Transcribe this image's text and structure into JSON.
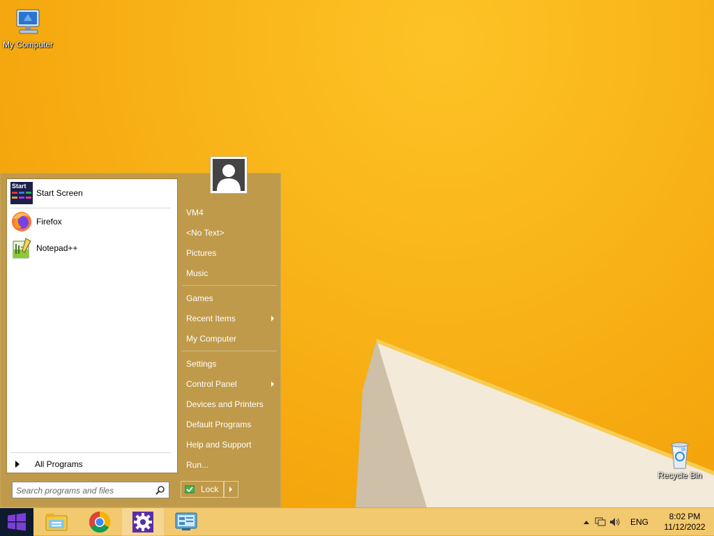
{
  "desktop": {
    "icons": [
      {
        "label": "My Computer"
      },
      {
        "label": "Recycle Bin"
      }
    ]
  },
  "start_menu": {
    "pinned": [
      {
        "label": "Start Screen",
        "icon": "start-screen-icon",
        "icon_text": "Start"
      },
      {
        "label": "Firefox",
        "icon": "firefox-icon"
      },
      {
        "label": "Notepad++",
        "icon": "notepad-plus-plus-icon"
      }
    ],
    "all_programs": "All Programs",
    "search_placeholder": "Search programs and files",
    "user_picture": "user-avatar-icon",
    "right_items": [
      {
        "label": "VM4",
        "submenu": false
      },
      {
        "label": "<No Text>",
        "submenu": false
      },
      {
        "label": "Pictures",
        "submenu": false
      },
      {
        "label": "Music",
        "submenu": false
      },
      {
        "label": "Games",
        "submenu": false
      },
      {
        "label": "Recent Items",
        "submenu": true
      },
      {
        "label": "My Computer",
        "submenu": false
      },
      {
        "label": "Settings",
        "submenu": false
      },
      {
        "label": "Control Panel",
        "submenu": true
      },
      {
        "label": "Devices and Printers",
        "submenu": false
      },
      {
        "label": "Default Programs",
        "submenu": false
      },
      {
        "label": "Help and Support",
        "submenu": false
      },
      {
        "label": "Run...",
        "submenu": false
      }
    ],
    "lock_label": "Lock"
  },
  "taskbar": {
    "apps": [
      "file-explorer-icon",
      "chrome-icon",
      "settings-gear-icon",
      "control-panel-icon"
    ],
    "tray": {
      "language": "ENG",
      "time": "8:02 PM",
      "date": "11/12/2022"
    }
  },
  "colors": {
    "wallpaper": "#f6ac0e",
    "menu_bg": "#bf9a4a",
    "taskbar_bg": "#f2c96e",
    "start_button": "#0f1a2e"
  }
}
